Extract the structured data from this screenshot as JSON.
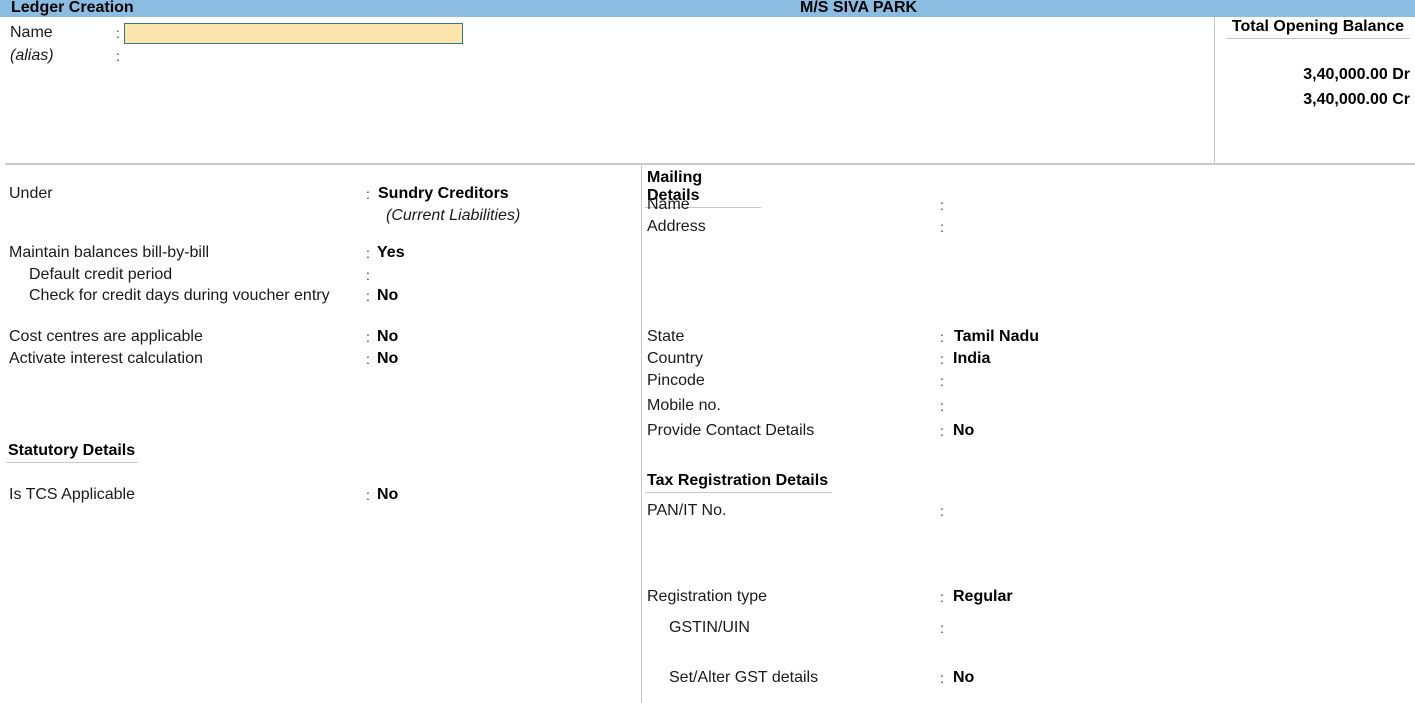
{
  "header": {
    "screen_title": "Ledger Creation",
    "company": "M/S SIVA PARK",
    "bar_color": "#8bbde3"
  },
  "top": {
    "name_label": "Name",
    "name_value": "",
    "alias_label": "(alias)",
    "input_color": "#fde3ac"
  },
  "opening_balance": {
    "title": "Total Opening Balance",
    "debit": "3,40,000.00 Dr",
    "credit": "3,40,000.00 Cr"
  },
  "left": {
    "under": {
      "label": "Under",
      "value": "Sundry Creditors",
      "sub": "(Current Liabilities)"
    },
    "bill_by_bill": {
      "label": "Maintain balances bill-by-bill",
      "value": "Yes"
    },
    "default_credit_period": {
      "label": "Default credit period",
      "value": ""
    },
    "check_credit_days": {
      "label": "Check for credit days during voucher entry",
      "value": "No"
    },
    "cost_centres": {
      "label": "Cost centres are applicable",
      "value": "No"
    },
    "interest_calc": {
      "label": "Activate interest calculation",
      "value": "No"
    },
    "statutory_title": "Statutory Details",
    "tcs": {
      "label": "Is TCS Applicable",
      "value": "No"
    }
  },
  "mailing": {
    "title": "Mailing Details",
    "name": {
      "label": "Name",
      "value": ""
    },
    "address": {
      "label": "Address",
      "value": ""
    },
    "state": {
      "label": "State",
      "value": "Tamil Nadu"
    },
    "country": {
      "label": "Country",
      "value": "India"
    },
    "pincode": {
      "label": "Pincode",
      "value": ""
    },
    "mobile": {
      "label": "Mobile no.",
      "value": ""
    },
    "contact": {
      "label": "Provide Contact Details",
      "value": "No"
    }
  },
  "tax": {
    "title": "Tax Registration Details",
    "pan": {
      "label": "PAN/IT No.",
      "value": ""
    },
    "reg_type": {
      "label": "Registration type",
      "value": "Regular"
    },
    "gstin": {
      "label": "GSTIN/UIN",
      "value": ""
    },
    "gst_details": {
      "label": "Set/Alter GST details",
      "value": "No"
    }
  },
  "colon": ":"
}
